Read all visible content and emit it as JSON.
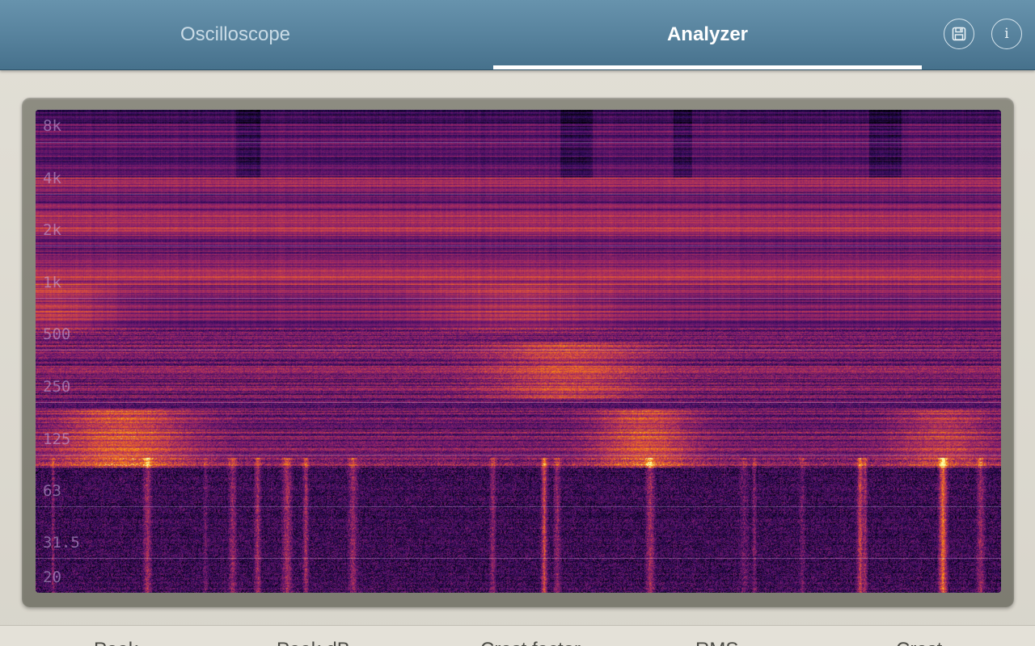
{
  "header": {
    "tabs": [
      {
        "label": "Oscilloscope",
        "active": false
      },
      {
        "label": "Analyzer",
        "active": true
      }
    ],
    "icons": {
      "save": "floppy-disk-icon",
      "info": "info-icon",
      "info_glyph": "i"
    }
  },
  "spectrogram": {
    "freq_labels": [
      "8k",
      "4k",
      "2k",
      "1k",
      "500",
      "250",
      "125",
      "63",
      "31.5",
      "20"
    ],
    "colormap": [
      "#000004",
      "#2b0b57",
      "#6a176e",
      "#a52c60",
      "#dd513a",
      "#f98e09",
      "#fcffa4"
    ]
  },
  "stats": {
    "labels": [
      "Peak",
      "Peak dB",
      "Crest factor",
      "RMS",
      "Crest"
    ]
  },
  "colors": {
    "header": "#56819c",
    "background": "#dedbd1",
    "frame": "#8d8c81"
  }
}
